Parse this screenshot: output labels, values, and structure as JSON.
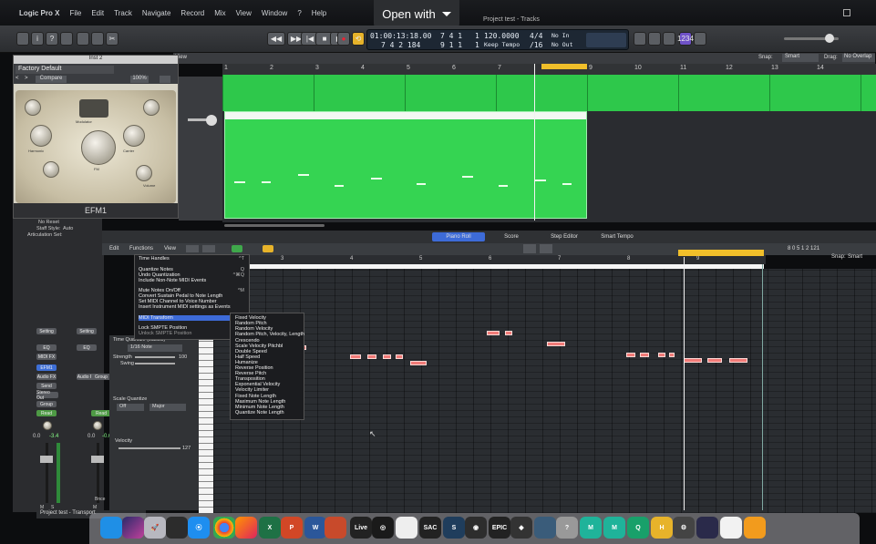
{
  "menubar": {
    "app": "Logic Pro X",
    "items": [
      "File",
      "Edit",
      "Track",
      "Navigate",
      "Record",
      "Mix",
      "View",
      "Window",
      "?",
      "Help"
    ]
  },
  "overlay": {
    "open_with": "Open with"
  },
  "window_title": "Project test - Tracks",
  "lcd": {
    "time": "01:00:13:18.00",
    "time_top_bars": "7 4 1",
    "time_top_ticks": "1",
    "position": "7 4 2 184",
    "position_right": "9 1 1",
    "position_right_ticks": "1",
    "tempo": "120.0000",
    "tempo_label": "Keep Tempo",
    "signature": "4/4",
    "division": "/16",
    "in_label": "No In",
    "out_label": "No Out"
  },
  "control_right": {
    "badge": "1234"
  },
  "tracks_header": {
    "snap_label": "Snap:",
    "snap_value": "Smart",
    "drag_label": "Drag:",
    "drag_value": "No Overlap",
    "view": "View"
  },
  "ruler": [
    "1",
    "2",
    "3",
    "4",
    "5",
    "6",
    "7",
    "8",
    "9",
    "10",
    "11",
    "12",
    "13",
    "14"
  ],
  "plugin": {
    "title": "Inst 2",
    "preset": "Factory Default",
    "compare": "Compare",
    "zoom": "100%",
    "name": "EFM1",
    "labels": {
      "harmonic": "Harmonic",
      "modulator": "Modulator",
      "carrier": "Carrier",
      "fm": "FM",
      "sub_osc": "Sub Osc",
      "volume": "Volume"
    }
  },
  "inspector": {
    "no_reset": "No Reset",
    "staff_style_label": "Staff Style:",
    "staff_style_value": "Auto",
    "articulation_label": "Articulation Set:"
  },
  "editor_tabs": [
    "Piano Roll",
    "Score",
    "Step Editor",
    "Smart Tempo"
  ],
  "pr_toolbar": {
    "edit": "Edit",
    "functions": "Functions",
    "view": "View",
    "position": "8 0  5 1 2 121",
    "snap_label": "Snap:",
    "snap_value": "Smart"
  },
  "pr_ruler": [
    "2",
    "3",
    "4",
    "5",
    "6",
    "7",
    "8",
    "9"
  ],
  "functions_menu": [
    {
      "label": "Time Handles",
      "shortcut": "^T"
    },
    {
      "label": "Quantize Notes",
      "shortcut": "Q"
    },
    {
      "label": "Undo Quantization",
      "shortcut": "^⌘Q"
    },
    {
      "label": "Include Non-Note MIDI Events",
      "shortcut": ""
    },
    {
      "label": "Mute Notes On/Off",
      "shortcut": "^M"
    },
    {
      "label": "Convert Sustain Pedal to Note Length",
      "shortcut": ""
    },
    {
      "label": "Set MIDI Channel to Voice Number",
      "shortcut": ""
    },
    {
      "label": "Insert Instrument MIDI settings as Events",
      "shortcut": ""
    },
    {
      "label": "MIDI Transform",
      "shortcut": "▸"
    },
    {
      "label": "Lock SMPTE Position",
      "shortcut": "⌘⇧"
    },
    {
      "label": "Unlock SMPTE Position",
      "shortcut": "⌘⇧"
    }
  ],
  "transform_submenu": [
    "Fixed Velocity",
    "Random Pitch",
    "Random Velocity",
    "Random Pitch, Velocity, Length",
    "Crescendo",
    "Scale Velocity Pitchbl",
    "Double Speed",
    "Half Speed",
    "Humanize",
    "Reverse Position",
    "Reverse Pitch",
    "Transposition",
    "Exponential Velocity",
    "Velocity Limiter",
    "Fixed Note Length",
    "Maximum Note Length",
    "Minimum Note Length",
    "Quantize Note Length"
  ],
  "pr_left": {
    "time_quantize": "Time Quantize (classic)",
    "quantize_value": "1/16 Note",
    "strength_label": "Strength",
    "strength_value": "100",
    "swing_label": "Swing",
    "scale_quantize": "Scale Quantize",
    "scale_off": "Off",
    "scale_major": "Major",
    "velocity_label": "Velocity",
    "velocity_value": "127"
  },
  "mixer": {
    "setting": "Setting",
    "eq": "EQ",
    "midi_fx": "MIDI FX",
    "efm1": "EFM1",
    "audio_fx": "Audio FX",
    "send": "Send",
    "stereo_out": "Stereo Out",
    "read": "Read",
    "group": "Group",
    "val_left": "0.0",
    "val_left2": "-3.4",
    "val_right": "0.0",
    "val_right2": "-0.6",
    "bnce": "Bnce",
    "m": "M",
    "s": "S"
  },
  "transport_bar": "Project test - Transport",
  "dock": [
    "Finder",
    "Siri",
    "Launchpad",
    "Quicktime",
    "Safari",
    "Chrome",
    "Firefox",
    "Excel",
    "PowerPoint",
    "Word",
    "Ableton Live",
    "Logic",
    "Audacity",
    "SAC",
    "Shazam",
    "DaVinci",
    "Epic Games",
    "Unity",
    "Reaper",
    "Help",
    "MuseScore",
    "MuseScore 2",
    "Qobuz",
    "Honda",
    "Utility",
    "Screen",
    "Preview",
    "Photos",
    "Books"
  ]
}
